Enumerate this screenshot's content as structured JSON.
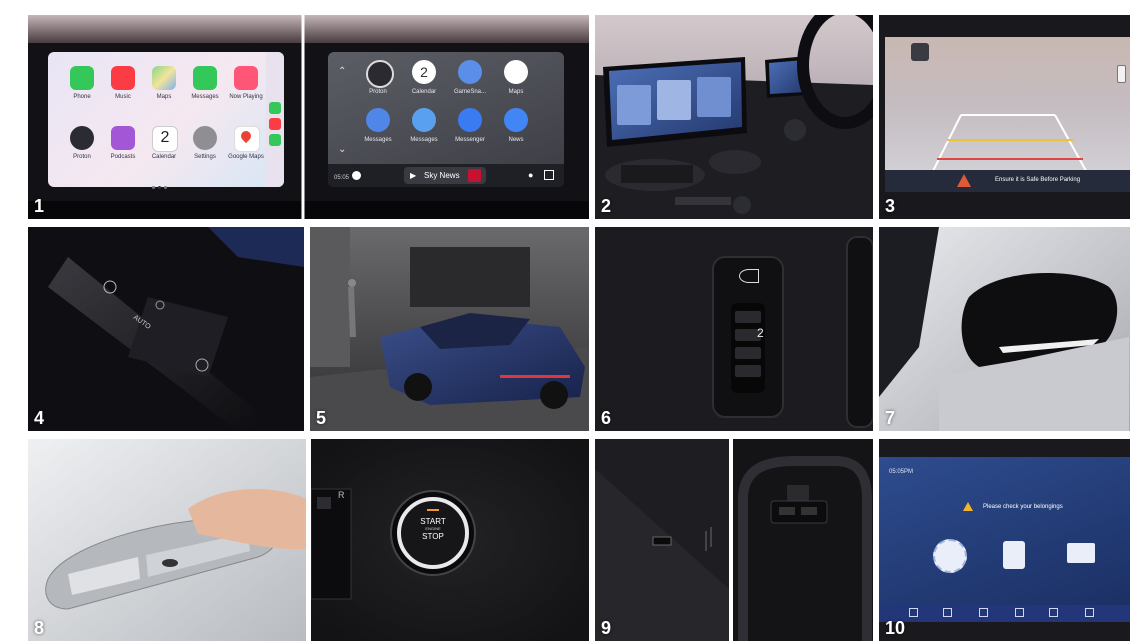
{
  "tiles": [
    {
      "number": "1"
    },
    {
      "number": "2"
    },
    {
      "number": "3"
    },
    {
      "number": "4"
    },
    {
      "number": "5"
    },
    {
      "number": "6"
    },
    {
      "number": "7"
    },
    {
      "number": "8"
    },
    {
      "number": "9"
    },
    {
      "number": "10"
    }
  ],
  "carplay": {
    "apps": [
      "Phone",
      "Music",
      "Maps",
      "Messages",
      "Proton",
      "Podcasts",
      "Calendar",
      "Settings",
      "Google Maps"
    ],
    "partial_label": "Now Playing",
    "calendar_day": "2",
    "colors": {
      "phone": "#34c759",
      "music": "#fc3c44",
      "messages": "#34c759",
      "maps": "#4a90e2"
    }
  },
  "android_auto": {
    "apps": [
      "Proton",
      "Calendar",
      "GameSna...",
      "Maps",
      "Messages",
      "Messages",
      "Messenger",
      "News"
    ],
    "calendar_day": "2",
    "now_playing": "Sky News",
    "time": "05:05"
  },
  "reverse_camera": {
    "warning": "Ensure it is Safe Before Parking"
  },
  "stalk": {
    "auto_label": "AUTO"
  },
  "headlamp_level": {
    "value_label": "2"
  },
  "start_button": {
    "line1": "START",
    "line2": "ENGINE",
    "line3": "STOP",
    "side_label": "R"
  },
  "rear_reminder": {
    "time": "05:05PM",
    "message": "Please check your belongings"
  }
}
